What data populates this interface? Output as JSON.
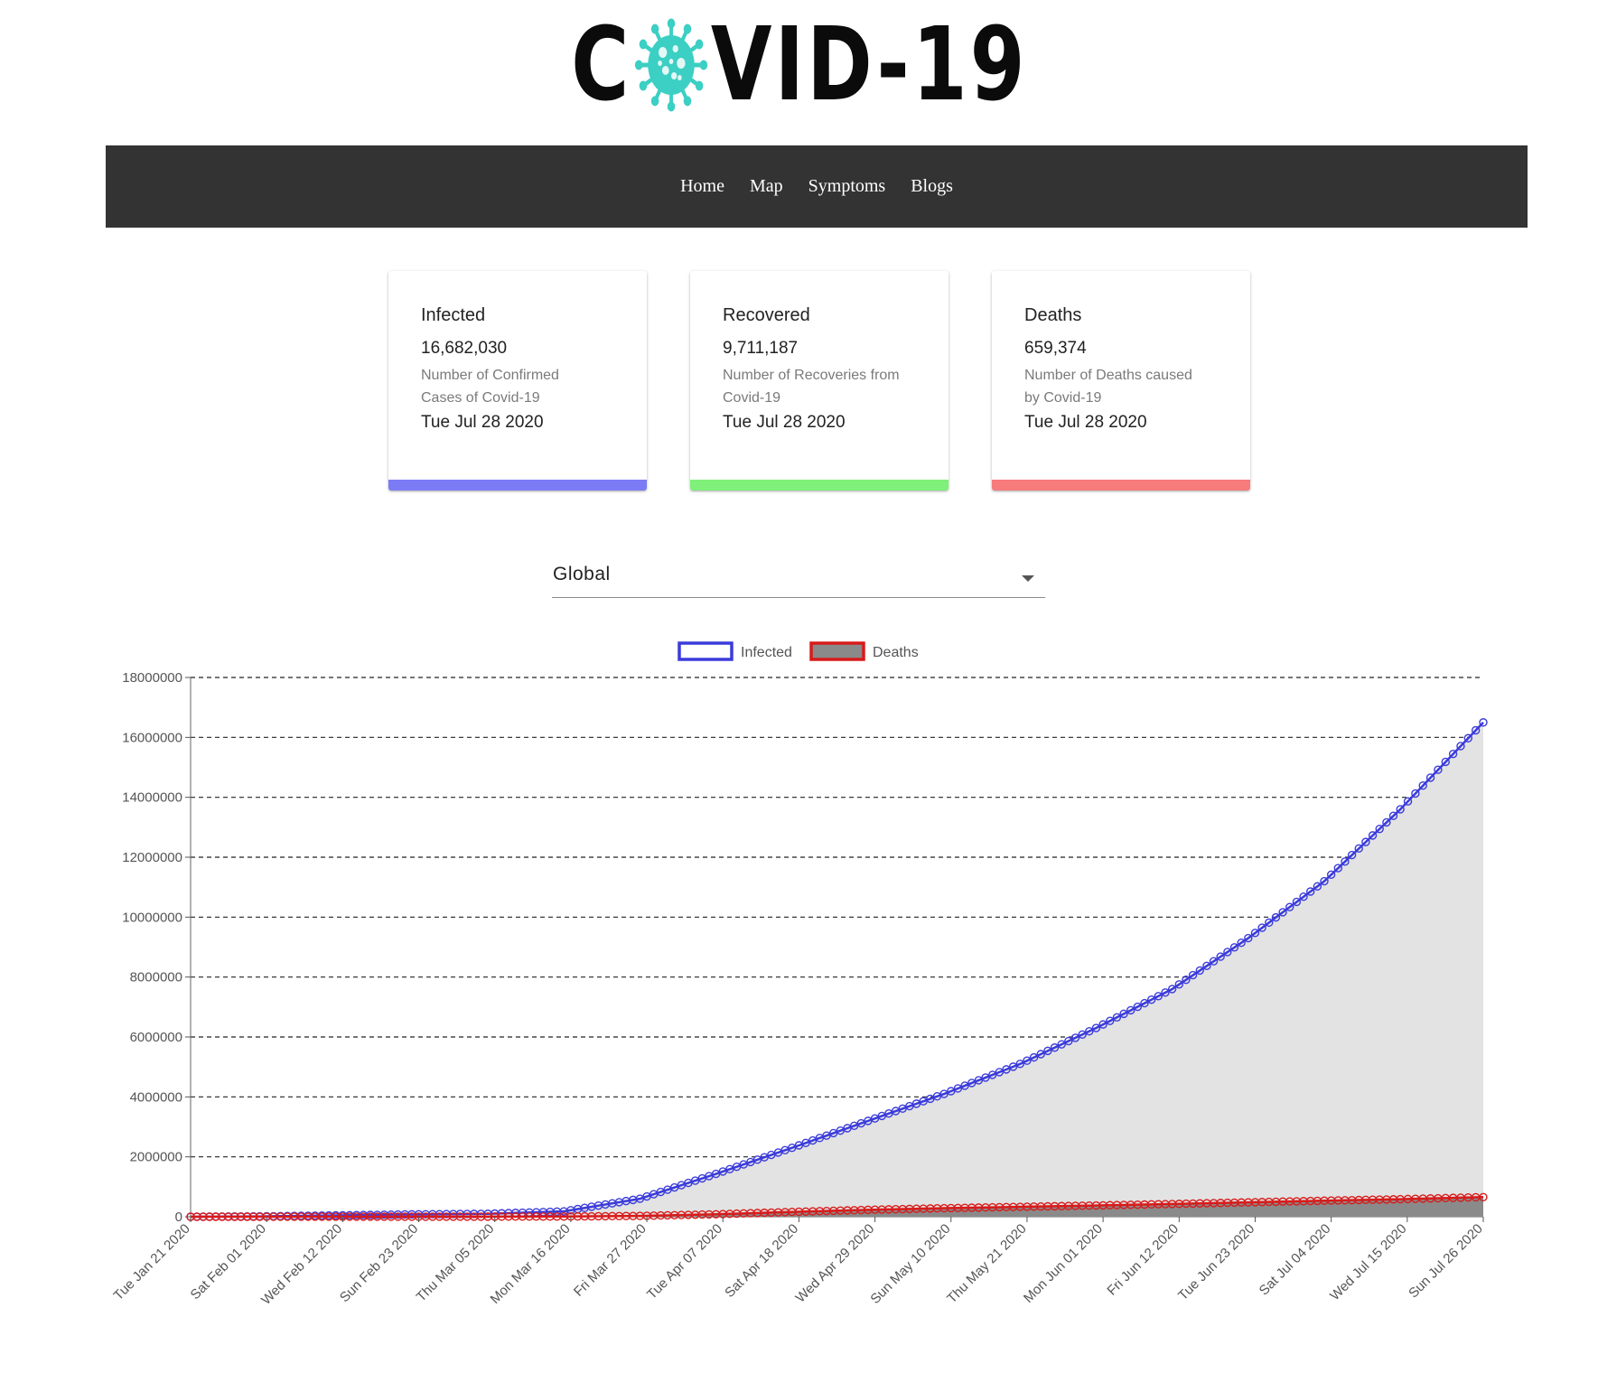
{
  "logo": {
    "text_left": "C",
    "text_right": "VID-19",
    "virus_color": "#3ccfc4"
  },
  "nav": {
    "items": [
      "Home",
      "Map",
      "Symptoms",
      "Blogs"
    ]
  },
  "cards": [
    {
      "title": "Infected",
      "value": "16,682,030",
      "description": "Number of Confirmed Cases of Covid-19",
      "date": "Tue Jul 28 2020",
      "bar_color": "#7b7bf5"
    },
    {
      "title": "Recovered",
      "value": "9,711,187",
      "description": "Number of Recoveries from Covid-19",
      "date": "Tue Jul 28 2020",
      "bar_color": "#7ff07a"
    },
    {
      "title": "Deaths",
      "value": "659,374",
      "description": "Number of Deaths caused by Covid-19",
      "date": "Tue Jul 28 2020",
      "bar_color": "#f77b7b"
    }
  ],
  "country_select": {
    "value": "Global"
  },
  "chart_data": {
    "type": "area",
    "x_tick_labels": [
      "Tue Jan 21 2020",
      "Sat Feb 01 2020",
      "Wed Feb 12 2020",
      "Sun Feb 23 2020",
      "Thu Mar 05 2020",
      "Mon Mar 16 2020",
      "Fri Mar 27 2020",
      "Tue Apr 07 2020",
      "Sat Apr 18 2020",
      "Wed Apr 29 2020",
      "Sun May 10 2020",
      "Thu May 21 2020",
      "Mon Jun 01 2020",
      "Fri Jun 12 2020",
      "Tue Jun 23 2020",
      "Sat Jul 04 2020",
      "Wed Jul 15 2020",
      "Sun Jul 26 2020"
    ],
    "x_range": [
      "2020-01-22",
      "2020-07-27"
    ],
    "ylim": [
      0,
      18000000
    ],
    "y_ticks": [
      0,
      2000000,
      4000000,
      6000000,
      8000000,
      10000000,
      12000000,
      14000000,
      16000000,
      18000000
    ],
    "grid": "horizontal dashed",
    "legend_position": "top-center",
    "series": [
      {
        "name": "Infected",
        "stroke": "#3b3bdb",
        "fill": "#e3e3e3",
        "points": [
          [
            "2020-01-22",
            555
          ],
          [
            "2020-02-01",
            12000
          ],
          [
            "2020-02-12",
            45000
          ],
          [
            "2020-02-23",
            79000
          ],
          [
            "2020-03-05",
            98000
          ],
          [
            "2020-03-16",
            180000
          ],
          [
            "2020-03-27",
            600000
          ],
          [
            "2020-04-07",
            1430000
          ],
          [
            "2020-04-18",
            2300000
          ],
          [
            "2020-04-29",
            3200000
          ],
          [
            "2020-05-10",
            4100000
          ],
          [
            "2020-05-21",
            5100000
          ],
          [
            "2020-06-01",
            6300000
          ],
          [
            "2020-06-12",
            7600000
          ],
          [
            "2020-06-23",
            9300000
          ],
          [
            "2020-07-04",
            11200000
          ],
          [
            "2020-07-15",
            13600000
          ],
          [
            "2020-07-27",
            16500000
          ]
        ]
      },
      {
        "name": "Deaths",
        "stroke": "#d81b1b",
        "fill": "#8a8a8a",
        "points": [
          [
            "2020-01-22",
            17
          ],
          [
            "2020-02-01",
            260
          ],
          [
            "2020-02-12",
            1100
          ],
          [
            "2020-02-23",
            2500
          ],
          [
            "2020-03-05",
            3400
          ],
          [
            "2020-03-16",
            7500
          ],
          [
            "2020-03-27",
            27000
          ],
          [
            "2020-04-07",
            82000
          ],
          [
            "2020-04-18",
            160000
          ],
          [
            "2020-04-29",
            230000
          ],
          [
            "2020-05-10",
            285000
          ],
          [
            "2020-05-21",
            330000
          ],
          [
            "2020-06-01",
            375000
          ],
          [
            "2020-06-12",
            425000
          ],
          [
            "2020-06-23",
            480000
          ],
          [
            "2020-07-04",
            535000
          ],
          [
            "2020-07-15",
            585000
          ],
          [
            "2020-07-27",
            655000
          ]
        ]
      }
    ]
  }
}
